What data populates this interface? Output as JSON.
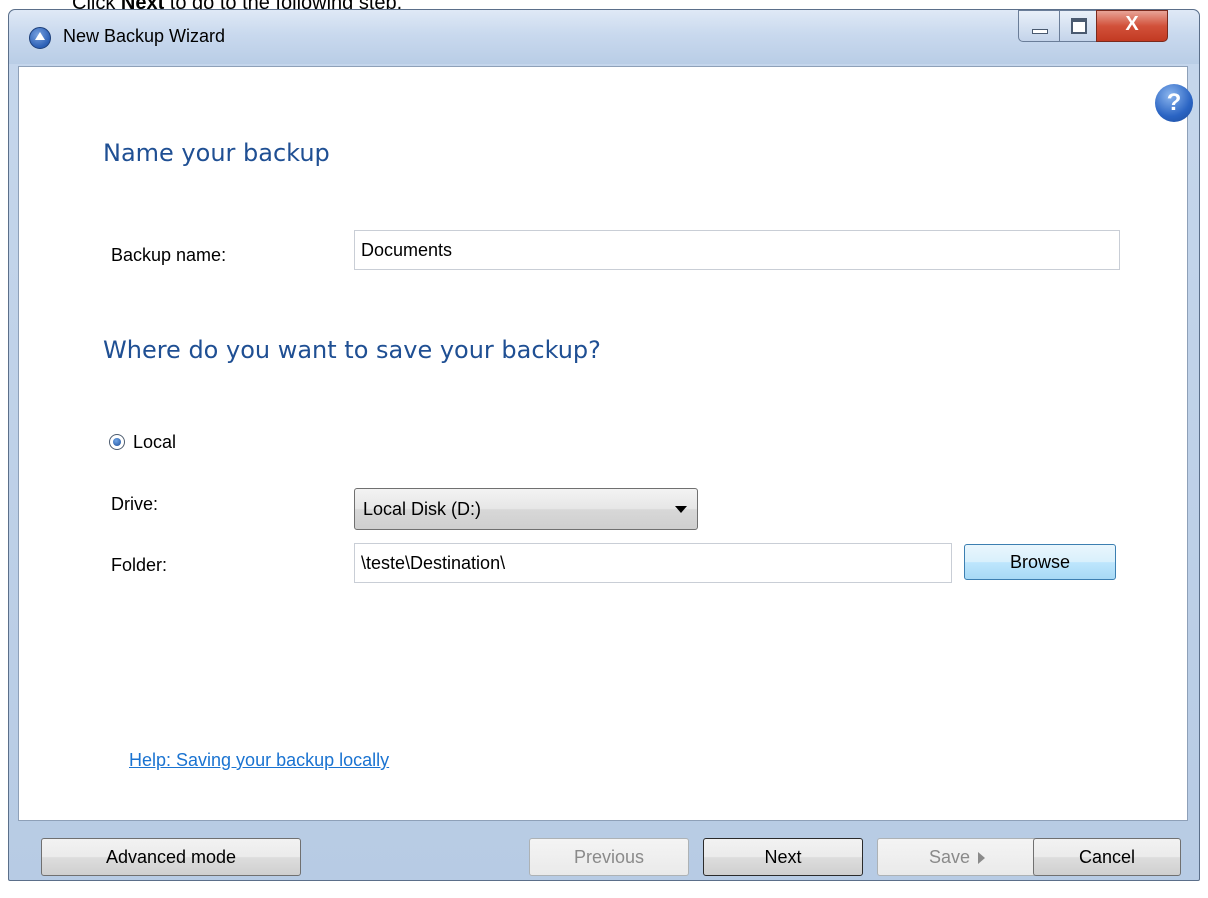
{
  "doc_caption": {
    "prefix": "Click ",
    "bold": "Next",
    "suffix": " to go to the following step."
  },
  "window": {
    "title": "New Backup Wizard",
    "close_glyph": "X"
  },
  "wizard": {
    "help_glyph": "?",
    "name_heading": "Name your backup",
    "backup_name_label": "Backup name:",
    "backup_name_value": "Documents",
    "location_heading": "Where do you want to save your backup?",
    "local_option_label": "Local",
    "local_selected": true,
    "drive_label": "Drive:",
    "drive_value": "Local Disk (D:)",
    "folder_label": "Folder:",
    "folder_value": "\\teste\\Destination\\",
    "browse_label": "Browse",
    "help_link": "Help: Saving your backup locally"
  },
  "footer": {
    "advanced_mode": "Advanced mode",
    "previous": "Previous",
    "next": "Next",
    "save": "Save",
    "cancel": "Cancel"
  },
  "colors": {
    "heading": "#1f4f93",
    "link": "#1a73d1",
    "titlebar": "#c9d9ee",
    "close_button": "#c23a22"
  },
  "icons": {
    "app": "backup-app-icon",
    "help": "help-icon",
    "dropdown": "chevron-down-icon",
    "save_arrow": "play-arrow-icon"
  }
}
